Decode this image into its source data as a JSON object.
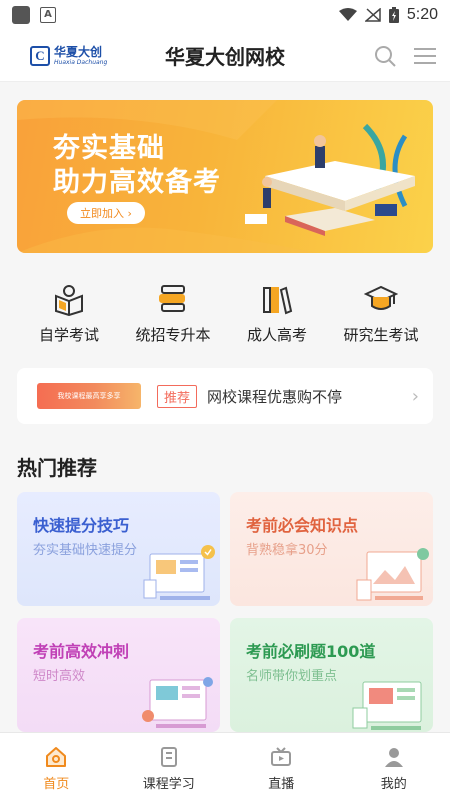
{
  "status_bar": {
    "time": "5:20",
    "notif_icon_letter": "A"
  },
  "header": {
    "logo_cn": "华夏大创",
    "logo_en": "Huaxia Dachuang",
    "title": "华夏大创网校"
  },
  "banner": {
    "line1": "夯实基础",
    "line2": "助力高效备考",
    "button": "立即加入 ›"
  },
  "categories": [
    {
      "label": "自学考试",
      "icon": "book-reader-icon"
    },
    {
      "label": "统招专升本",
      "icon": "stacked-books-icon"
    },
    {
      "label": "成人高考",
      "icon": "bookshelf-icon"
    },
    {
      "label": "研究生考试",
      "icon": "graduation-cap-icon"
    }
  ],
  "promo": {
    "image_text": "我校课程最高享多享",
    "tag": "推荐",
    "text": "网校课程优惠购不停",
    "arrow": "›"
  },
  "section": {
    "title": "热门推荐"
  },
  "cards": [
    {
      "title": "快速提分技巧",
      "subtitle": "夯实基础快速提分"
    },
    {
      "title": "考前必会知识点",
      "subtitle": "背熟稳拿30分"
    },
    {
      "title": "考前高效冲刺",
      "subtitle": "短时高效"
    },
    {
      "title": "考前必刷题100道",
      "subtitle": "名师带你划重点"
    }
  ],
  "tabs": [
    {
      "label": "首页",
      "icon": "home-icon",
      "active": true
    },
    {
      "label": "课程学习",
      "icon": "course-icon",
      "active": false
    },
    {
      "label": "直播",
      "icon": "live-tv-icon",
      "active": false
    },
    {
      "label": "我的",
      "icon": "profile-icon",
      "active": false
    }
  ],
  "colors": {
    "accent": "#f08a1d",
    "brand_blue": "#1d4fa8"
  }
}
